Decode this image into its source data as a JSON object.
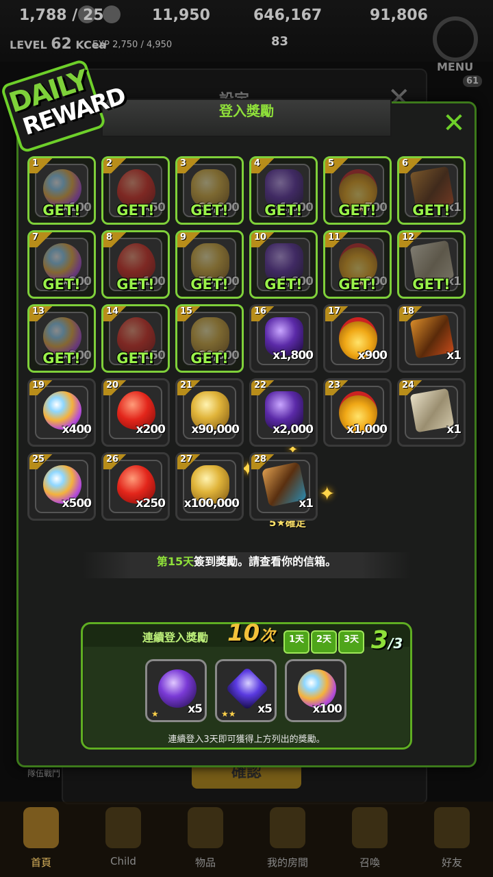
{
  "topbar": {
    "stamina": "1,788 / 258",
    "coins": "11,950",
    "gold": "646,167",
    "gems": "91,806",
    "level_label": "LEVEL",
    "level": "62",
    "player_name": "KCea",
    "exp": "EXP 2,750 / 4,950",
    "hearts": "83",
    "menu_label": "MENU",
    "menu_count": "61"
  },
  "background": {
    "settings_title": "設定",
    "confirm_label": "確認",
    "side_text_1": "隊伍戰鬥"
  },
  "badge": {
    "line1": "DAILY",
    "line2": "REWARD"
  },
  "dialog": {
    "title": "登入獎勵",
    "close_symbol": "✕"
  },
  "get_label": "GET!",
  "rewards": [
    {
      "day": "1",
      "qty": "x100",
      "type": "gem",
      "claimed": true
    },
    {
      "day": "2",
      "qty": "x50",
      "type": "heart",
      "claimed": true
    },
    {
      "day": "3",
      "qty": "x80,000",
      "type": "coin",
      "claimed": true
    },
    {
      "day": "4",
      "qty": "x1,600",
      "type": "crystal",
      "claimed": true
    },
    {
      "day": "5",
      "qty": "x700",
      "type": "medal",
      "claimed": true
    },
    {
      "day": "6",
      "qty": "x1",
      "type": "ticket",
      "claimed": true
    },
    {
      "day": "7",
      "qty": "x200",
      "type": "gem",
      "claimed": true
    },
    {
      "day": "8",
      "qty": "x100",
      "type": "heart",
      "claimed": true
    },
    {
      "day": "9",
      "qty": "x70,000",
      "type": "coin",
      "claimed": true
    },
    {
      "day": "10",
      "qty": "x1,600",
      "type": "crystal",
      "claimed": true
    },
    {
      "day": "11",
      "qty": "x800",
      "type": "medal",
      "claimed": true
    },
    {
      "day": "12",
      "qty": "x1",
      "type": "gold",
      "claimed": true
    },
    {
      "day": "13",
      "qty": "x300",
      "type": "gem",
      "claimed": true
    },
    {
      "day": "14",
      "qty": "x150",
      "type": "heart",
      "claimed": true
    },
    {
      "day": "15",
      "qty": "x80,000",
      "type": "coin",
      "claimed": true
    },
    {
      "day": "16",
      "qty": "x1,800",
      "type": "crystal",
      "claimed": false
    },
    {
      "day": "17",
      "qty": "x900",
      "type": "medal",
      "claimed": false
    },
    {
      "day": "18",
      "qty": "x1",
      "type": "ticket",
      "claimed": false
    },
    {
      "day": "19",
      "qty": "x400",
      "type": "gem",
      "claimed": false
    },
    {
      "day": "20",
      "qty": "x200",
      "type": "heart",
      "claimed": false
    },
    {
      "day": "21",
      "qty": "x90,000",
      "type": "coin",
      "claimed": false
    },
    {
      "day": "22",
      "qty": "x2,000",
      "type": "crystal",
      "claimed": false
    },
    {
      "day": "23",
      "qty": "x1,000",
      "type": "medal",
      "claimed": false
    },
    {
      "day": "24",
      "qty": "x1",
      "type": "gold",
      "claimed": false
    },
    {
      "day": "25",
      "qty": "x500",
      "type": "gem",
      "claimed": false
    },
    {
      "day": "26",
      "qty": "x250",
      "type": "heart",
      "claimed": false
    },
    {
      "day": "27",
      "qty": "x100,000",
      "type": "coin",
      "claimed": false
    },
    {
      "day": "28",
      "qty": "x1",
      "type": "special",
      "claimed": false
    }
  ],
  "special_label": "5★確定",
  "info": {
    "highlight": "第15天",
    "text": "簽到獎勵。請查看你的信箱。"
  },
  "streak": {
    "title": "連續登入獎勵",
    "count": "10",
    "count_unit": "次",
    "days": [
      "1天",
      "2天",
      "3天"
    ],
    "progress": "3",
    "progress_total": "/3",
    "items": [
      {
        "qty": "x5",
        "type": "orb",
        "stars": "★"
      },
      {
        "qty": "x5",
        "type": "prism",
        "stars": "★★"
      },
      {
        "qty": "x100",
        "type": "gem",
        "stars": ""
      }
    ],
    "note": "連續登入3天即可獲得上方列出的獎勵。"
  },
  "nav": [
    {
      "label": "首頁",
      "active": true
    },
    {
      "label": "Child",
      "active": false
    },
    {
      "label": "物品",
      "active": false
    },
    {
      "label": "我的房間",
      "active": false
    },
    {
      "label": "召喚",
      "active": false
    },
    {
      "label": "好友",
      "active": false
    }
  ]
}
